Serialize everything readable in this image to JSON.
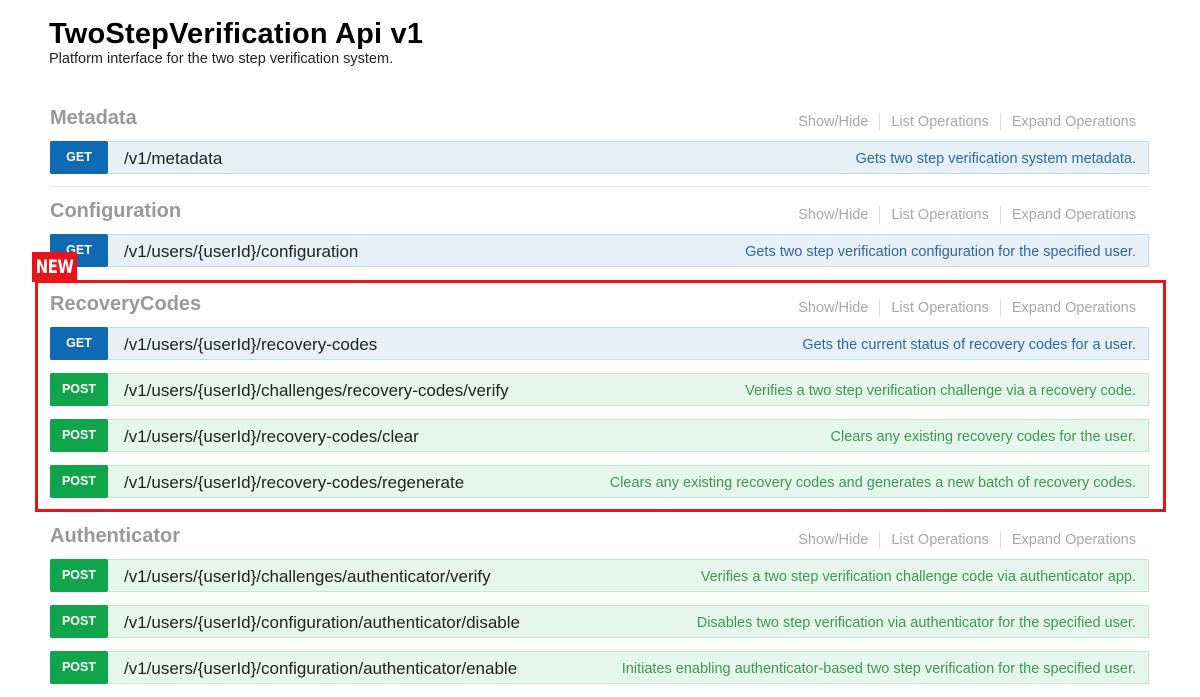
{
  "header": {
    "title": "TwoStepVerification Api v1",
    "subtitle": "Platform interface for the two step verification system."
  },
  "section_links": {
    "show_hide": "Show/Hide",
    "list_operations": "List Operations",
    "expand_operations": "Expand Operations"
  },
  "annotation": {
    "badge": "NEW",
    "color": "#e8141b"
  },
  "colors": {
    "get": "#0f6ab4",
    "post": "#10a54a"
  },
  "sections": [
    {
      "name": "Metadata",
      "operations": [
        {
          "method": "GET",
          "path": "/v1/metadata",
          "description": "Gets two step verification system metadata."
        }
      ]
    },
    {
      "name": "Configuration",
      "operations": [
        {
          "method": "GET",
          "path": "/v1/users/{userId}/configuration",
          "description": "Gets two step verification configuration for the specified user."
        }
      ]
    },
    {
      "name": "RecoveryCodes",
      "operations": [
        {
          "method": "GET",
          "path": "/v1/users/{userId}/recovery-codes",
          "description": "Gets the current status of recovery codes for a user."
        },
        {
          "method": "POST",
          "path": "/v1/users/{userId}/challenges/recovery-codes/verify",
          "description": "Verifies a two step verification challenge via a recovery code."
        },
        {
          "method": "POST",
          "path": "/v1/users/{userId}/recovery-codes/clear",
          "description": "Clears any existing recovery codes for the user."
        },
        {
          "method": "POST",
          "path": "/v1/users/{userId}/recovery-codes/regenerate",
          "description": "Clears any existing recovery codes and generates a new batch of recovery codes."
        }
      ]
    },
    {
      "name": "Authenticator",
      "operations": [
        {
          "method": "POST",
          "path": "/v1/users/{userId}/challenges/authenticator/verify",
          "description": "Verifies a two step verification challenge code via authenticator app."
        },
        {
          "method": "POST",
          "path": "/v1/users/{userId}/configuration/authenticator/disable",
          "description": "Disables two step verification via authenticator for the specified user."
        },
        {
          "method": "POST",
          "path": "/v1/users/{userId}/configuration/authenticator/enable",
          "description": "Initiates enabling authenticator-based two step verification for the specified user."
        }
      ]
    }
  ]
}
